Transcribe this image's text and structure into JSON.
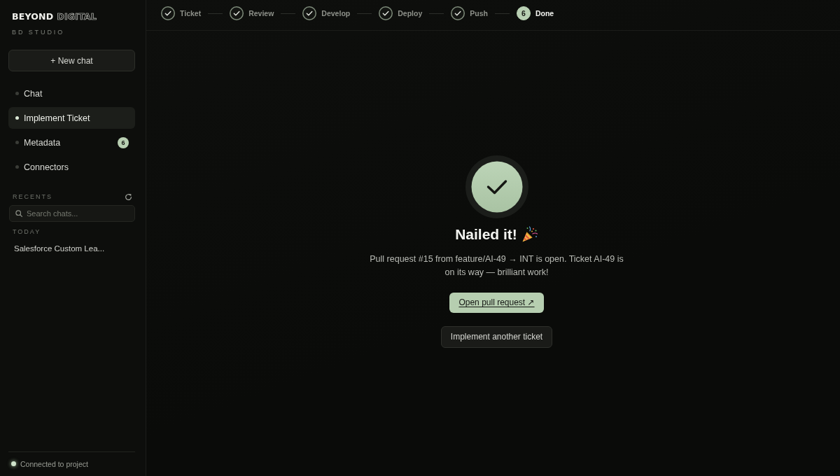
{
  "sidebar": {
    "logo": {
      "primary": "BEYOND",
      "secondary": "DIGITAL",
      "subtitle": "BD STUDIO"
    },
    "new_chat_button": "+ New chat",
    "nav_items": [
      {
        "label": "Chat",
        "selected": false
      },
      {
        "label": "Implement Ticket",
        "selected": true
      },
      {
        "label": "Metadata",
        "selected": false,
        "badge": "6"
      },
      {
        "label": "Connectors",
        "selected": false
      }
    ],
    "recents": {
      "title": "RECENTS",
      "search": {
        "placeholder": "Search chats..."
      },
      "groups": [
        {
          "label": "TODAY",
          "items": [
            {
              "title": "Salesforce Custom Lea..."
            }
          ]
        }
      ]
    },
    "status": {
      "label": "Connected to project",
      "connected": true
    }
  },
  "stepper": {
    "steps": [
      {
        "label": "Ticket",
        "done": true,
        "current": false
      },
      {
        "label": "Review",
        "done": true,
        "current": false
      },
      {
        "label": "Develop",
        "done": true,
        "current": false
      },
      {
        "label": "Deploy",
        "done": true,
        "current": false
      },
      {
        "label": "Push",
        "done": true,
        "current": false
      },
      {
        "label": "Done",
        "number": "6",
        "done": false,
        "current": true
      }
    ]
  },
  "result": {
    "title": "Nailed it!",
    "message": "Pull request #15 from feature/AI-49 → INT is open. Ticket AI-49 is on its way — brilliant work!",
    "primary_button": "Open pull request ↗",
    "secondary_button": "Implement another ticket"
  }
}
